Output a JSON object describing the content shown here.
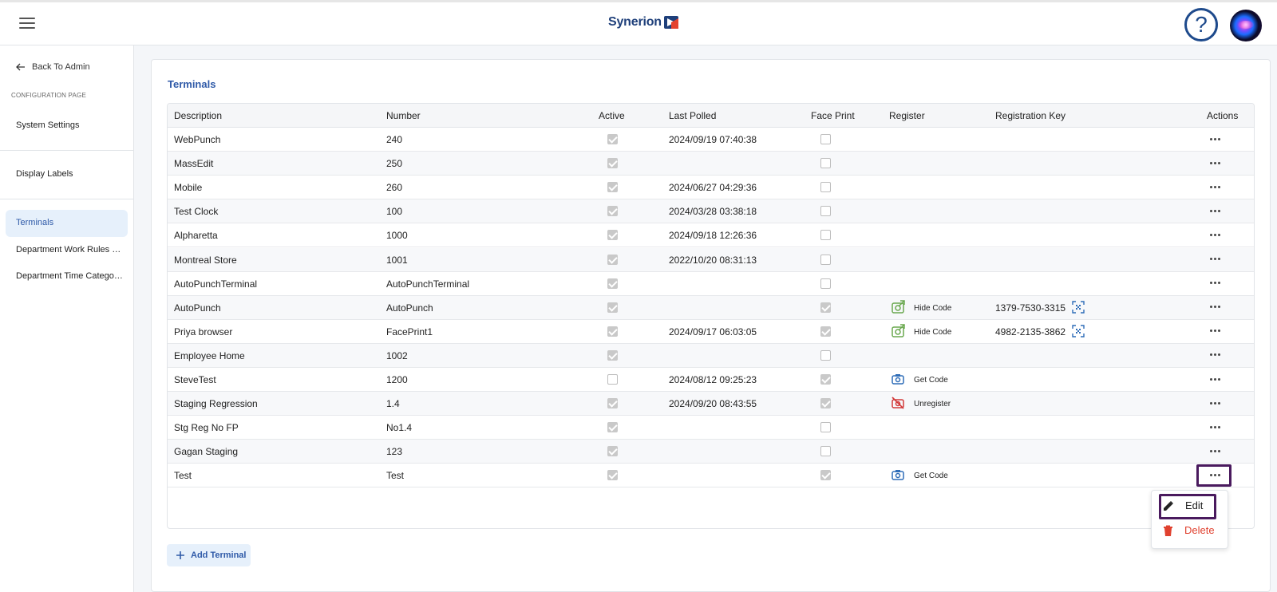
{
  "header": {
    "logo_text": "Synerion",
    "help_glyph": "?",
    "colors": {
      "brand": "#1e3f7a",
      "accent": "#2f5aa8"
    }
  },
  "sidebar": {
    "back_label": "Back To Admin",
    "section_label": "CONFIGURATION PAGE",
    "items": [
      {
        "label": "System Settings"
      },
      {
        "label": "Display Labels"
      },
      {
        "label": "Terminals",
        "active": true
      },
      {
        "label": "Department Work Rules Filt..."
      },
      {
        "label": "Department Time Category ..."
      }
    ]
  },
  "main": {
    "title": "Terminals",
    "columns": [
      "Description",
      "Number",
      "Active",
      "Last Polled",
      "Face Print",
      "Register",
      "Registration Key",
      "Actions"
    ],
    "rows": [
      {
        "description": "WebPunch",
        "number": "240",
        "active": true,
        "last_polled": "2024/09/19 07:40:38",
        "face_print": false,
        "register": "",
        "register_icon": "",
        "key": ""
      },
      {
        "description": "MassEdit",
        "number": "250",
        "active": true,
        "last_polled": "",
        "face_print": false,
        "register": "",
        "register_icon": "",
        "key": ""
      },
      {
        "description": "Mobile",
        "number": "260",
        "active": true,
        "last_polled": "2024/06/27 04:29:36",
        "face_print": false,
        "register": "",
        "register_icon": "",
        "key": ""
      },
      {
        "description": "Test Clock",
        "number": "100",
        "active": true,
        "last_polled": "2024/03/28 03:38:18",
        "face_print": false,
        "register": "",
        "register_icon": "",
        "key": ""
      },
      {
        "description": "Alpharetta",
        "number": "1000",
        "active": true,
        "last_polled": "2024/09/18 12:26:36",
        "face_print": false,
        "register": "",
        "register_icon": "",
        "key": ""
      },
      {
        "description": "Montreal Store",
        "number": "1001",
        "active": true,
        "last_polled": "2022/10/20 08:31:13",
        "face_print": false,
        "register": "",
        "register_icon": "",
        "key": ""
      },
      {
        "description": "AutoPunchTerminal",
        "number": "AutoPunchTerminal",
        "active": true,
        "last_polled": "",
        "face_print": false,
        "register": "",
        "register_icon": "",
        "key": ""
      },
      {
        "description": "AutoPunch",
        "number": "AutoPunch",
        "active": true,
        "last_polled": "",
        "face_print": true,
        "register": "Hide Code",
        "register_icon": "hide-code-icon",
        "key": "1379-7530-3315"
      },
      {
        "description": "Priya browser",
        "number": "FacePrint1",
        "active": true,
        "last_polled": "2024/09/17 06:03:05",
        "face_print": true,
        "register": "Hide Code",
        "register_icon": "hide-code-icon",
        "key": "4982-2135-3862"
      },
      {
        "description": "Employee Home",
        "number": "1002",
        "active": true,
        "last_polled": "",
        "face_print": false,
        "register": "",
        "register_icon": "",
        "key": ""
      },
      {
        "description": "SteveTest",
        "number": "1200",
        "active": false,
        "last_polled": "2024/08/12 09:25:23",
        "face_print": true,
        "register": "Get Code",
        "register_icon": "camera-icon",
        "key": ""
      },
      {
        "description": "Staging Regression",
        "number": "1.4",
        "active": true,
        "last_polled": "2024/09/20 08:43:55",
        "face_print": true,
        "register": "Unregister",
        "register_icon": "camera-off-icon",
        "key": ""
      },
      {
        "description": "Stg Reg No FP",
        "number": "No1.4",
        "active": true,
        "last_polled": "",
        "face_print": false,
        "register": "",
        "register_icon": "",
        "key": ""
      },
      {
        "description": "Gagan Staging",
        "number": "123",
        "active": true,
        "last_polled": "",
        "face_print": false,
        "register": "",
        "register_icon": "",
        "key": ""
      },
      {
        "description": "Test",
        "number": "Test",
        "active": true,
        "last_polled": "",
        "face_print": true,
        "register": "Get Code",
        "register_icon": "camera-icon",
        "key": ""
      }
    ],
    "actions_menu": {
      "edit_label": "Edit",
      "delete_label": "Delete"
    },
    "add_button_label": "Add Terminal"
  }
}
